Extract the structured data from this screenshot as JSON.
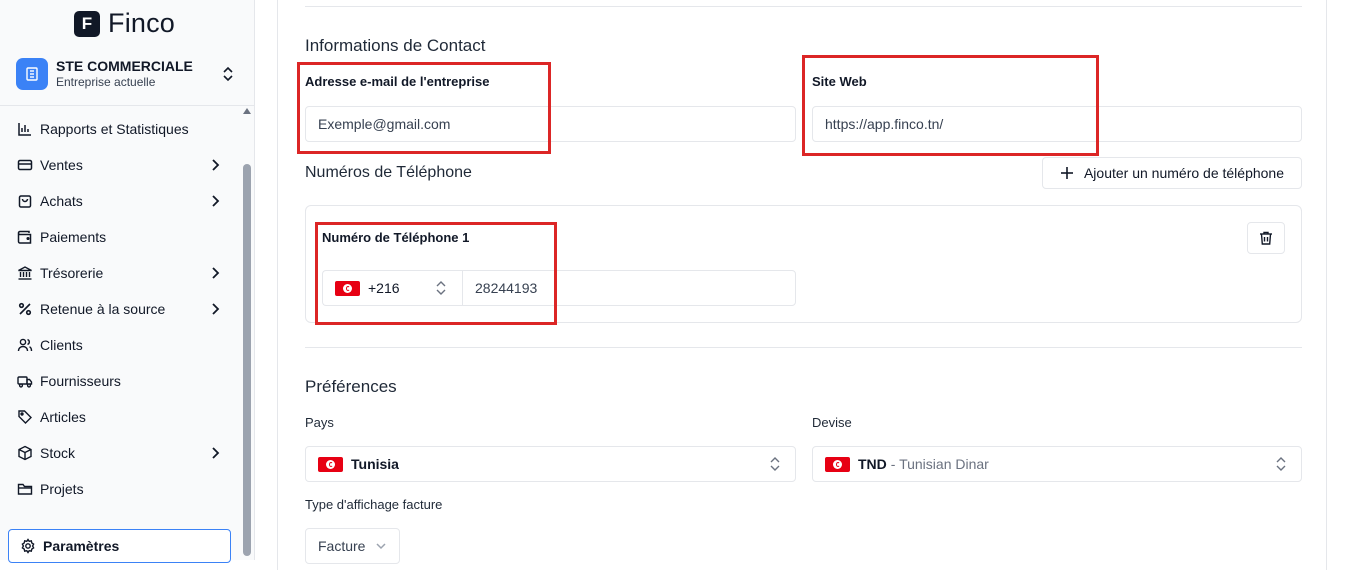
{
  "app": {
    "logo_letter": "F",
    "name": "Finco"
  },
  "company": {
    "name": "STE COMMERCIALE",
    "subtitle": "Entreprise actuelle"
  },
  "sidebar": {
    "items": [
      {
        "label": "Rapports et Statistiques",
        "icon": "bar-chart-icon",
        "has_submenu": false
      },
      {
        "label": "Ventes",
        "icon": "credit-card-icon",
        "has_submenu": true
      },
      {
        "label": "Achats",
        "icon": "shopping-bag-icon",
        "has_submenu": true
      },
      {
        "label": "Paiements",
        "icon": "wallet-icon",
        "has_submenu": false
      },
      {
        "label": "Trésorerie",
        "icon": "bank-icon",
        "has_submenu": true
      },
      {
        "label": "Retenue à la source",
        "icon": "percent-icon",
        "has_submenu": true
      },
      {
        "label": "Clients",
        "icon": "users-icon",
        "has_submenu": false
      },
      {
        "label": "Fournisseurs",
        "icon": "truck-icon",
        "has_submenu": false
      },
      {
        "label": "Articles",
        "icon": "tag-icon",
        "has_submenu": false
      },
      {
        "label": "Stock",
        "icon": "box-icon",
        "has_submenu": true
      },
      {
        "label": "Projets",
        "icon": "folder-icon",
        "has_submenu": false
      }
    ],
    "active_item": {
      "label": "Paramètres",
      "icon": "gear-icon"
    }
  },
  "contact": {
    "section_title": "Informations de Contact",
    "email_label": "Adresse e-mail de l'entreprise",
    "email_value": "Exemple@gmail.com",
    "website_label": "Site Web",
    "website_value": "https://app.finco.tn/"
  },
  "phones": {
    "section_title": "Numéros de Téléphone",
    "add_button": "Ajouter un numéro de téléphone",
    "entries": [
      {
        "label": "Numéro de Téléphone 1",
        "country_code": "+216",
        "number": "28244193"
      }
    ]
  },
  "preferences": {
    "section_title": "Préférences",
    "country_label": "Pays",
    "country_value": "Tunisia",
    "currency_label": "Devise",
    "currency_code": "TND",
    "currency_name": "- Tunisian Dinar",
    "invoice_type_label": "Type d'affichage facture",
    "invoice_type_value": "Facture"
  },
  "colors": {
    "accent": "#3b82f6",
    "highlight": "#dc2626",
    "flag_red": "#e70013"
  }
}
